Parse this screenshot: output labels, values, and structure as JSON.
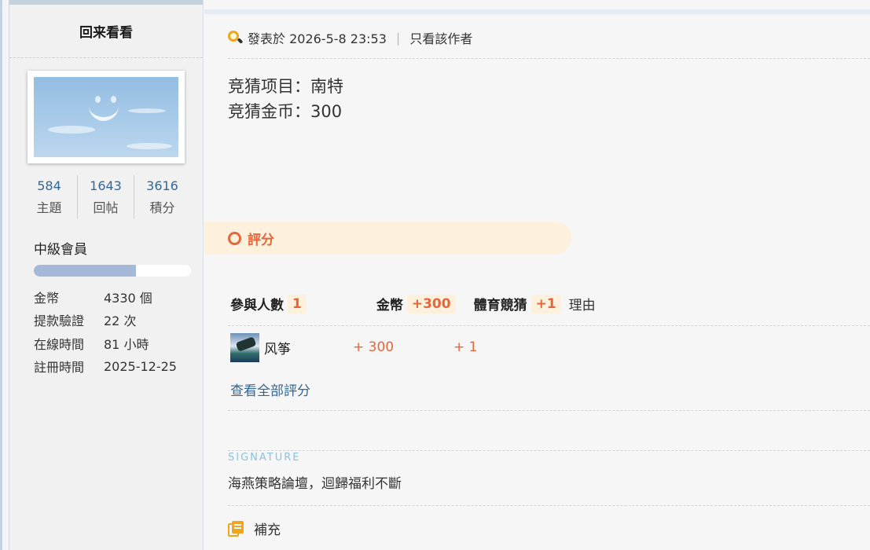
{
  "user": {
    "name": "回来看看",
    "stats": [
      {
        "value": "584",
        "label": "主題"
      },
      {
        "value": "1643",
        "label": "回帖"
      },
      {
        "value": "3616",
        "label": "積分"
      }
    ],
    "level": "中級會員",
    "level_progress": 0.65,
    "info": [
      {
        "label": "金幣",
        "value": "4330 個"
      },
      {
        "label": "提款驗證",
        "value": "22 次"
      },
      {
        "label": "在線時間",
        "value": "81 小時"
      },
      {
        "label": "註冊時間",
        "value": "2025-12-25"
      }
    ]
  },
  "post": {
    "posted_label": "發表於 2026-5-8 23:53",
    "separator": "|",
    "author_only": "只看該作者",
    "lines": [
      "竞猜项目：南特",
      "竞猜金币：300"
    ]
  },
  "rating": {
    "title": "評分",
    "participants_label": "參與人數",
    "participants_count": "1",
    "col_coins_label": "金幣",
    "col_coins_total": "+300",
    "col_sports_label": "體育競猜",
    "col_sports_total": "+1",
    "col_reason_label": "理由",
    "rows": [
      {
        "name": "风筝",
        "coins": "+ 300",
        "sports": "+ 1"
      }
    ],
    "view_all": "查看全部評分"
  },
  "signature": {
    "label": "SIGNATURE",
    "text": "海燕策略論壇，迴歸福利不斷"
  },
  "supplement": {
    "label": "補充"
  },
  "colors": {
    "accent_orange": "#e8643b",
    "link_blue": "#336699",
    "badge_bg": "#fdf1dd",
    "progress_fill": "#a5b8d8"
  }
}
